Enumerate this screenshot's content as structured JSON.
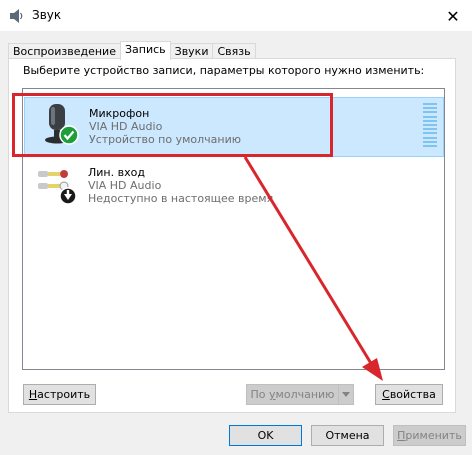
{
  "window": {
    "title": "Звук",
    "icon": "speaker-icon",
    "close_glyph": "✕"
  },
  "tabs": [
    {
      "label": "Воспроизведение",
      "active": false
    },
    {
      "label": "Запись",
      "active": true
    },
    {
      "label": "Звуки",
      "active": false
    },
    {
      "label": "Связь",
      "active": false
    }
  ],
  "panel": {
    "instruction": "Выберите устройство записи, параметры которого нужно изменить:"
  },
  "devices": [
    {
      "name": "Микрофон",
      "driver": "VIA HD Audio",
      "status": "Устройство по умолчанию",
      "icon": "microphone-icon",
      "badge": "default-checkmark-icon",
      "selected": true
    },
    {
      "name": "Лин. вход",
      "driver": "VIA HD Audio",
      "status": "Недоступно в настоящее время",
      "icon": "line-in-icon",
      "badge": "unavailable-arrow-icon",
      "selected": false
    }
  ],
  "panel_buttons": {
    "configure_underline": "Н",
    "configure_rest": "астроить",
    "set_default": "По умолчанию",
    "set_default_underline_char": "у",
    "properties_underline": "С",
    "properties_rest": "войства"
  },
  "footer_buttons": {
    "ok": "OK",
    "cancel": "Отмена",
    "apply_underline": "П",
    "apply_rest": "рименить"
  },
  "colors": {
    "selection_bg": "#cce8ff",
    "annotation_red": "#d9252c",
    "check_green": "#1e9e3a"
  }
}
